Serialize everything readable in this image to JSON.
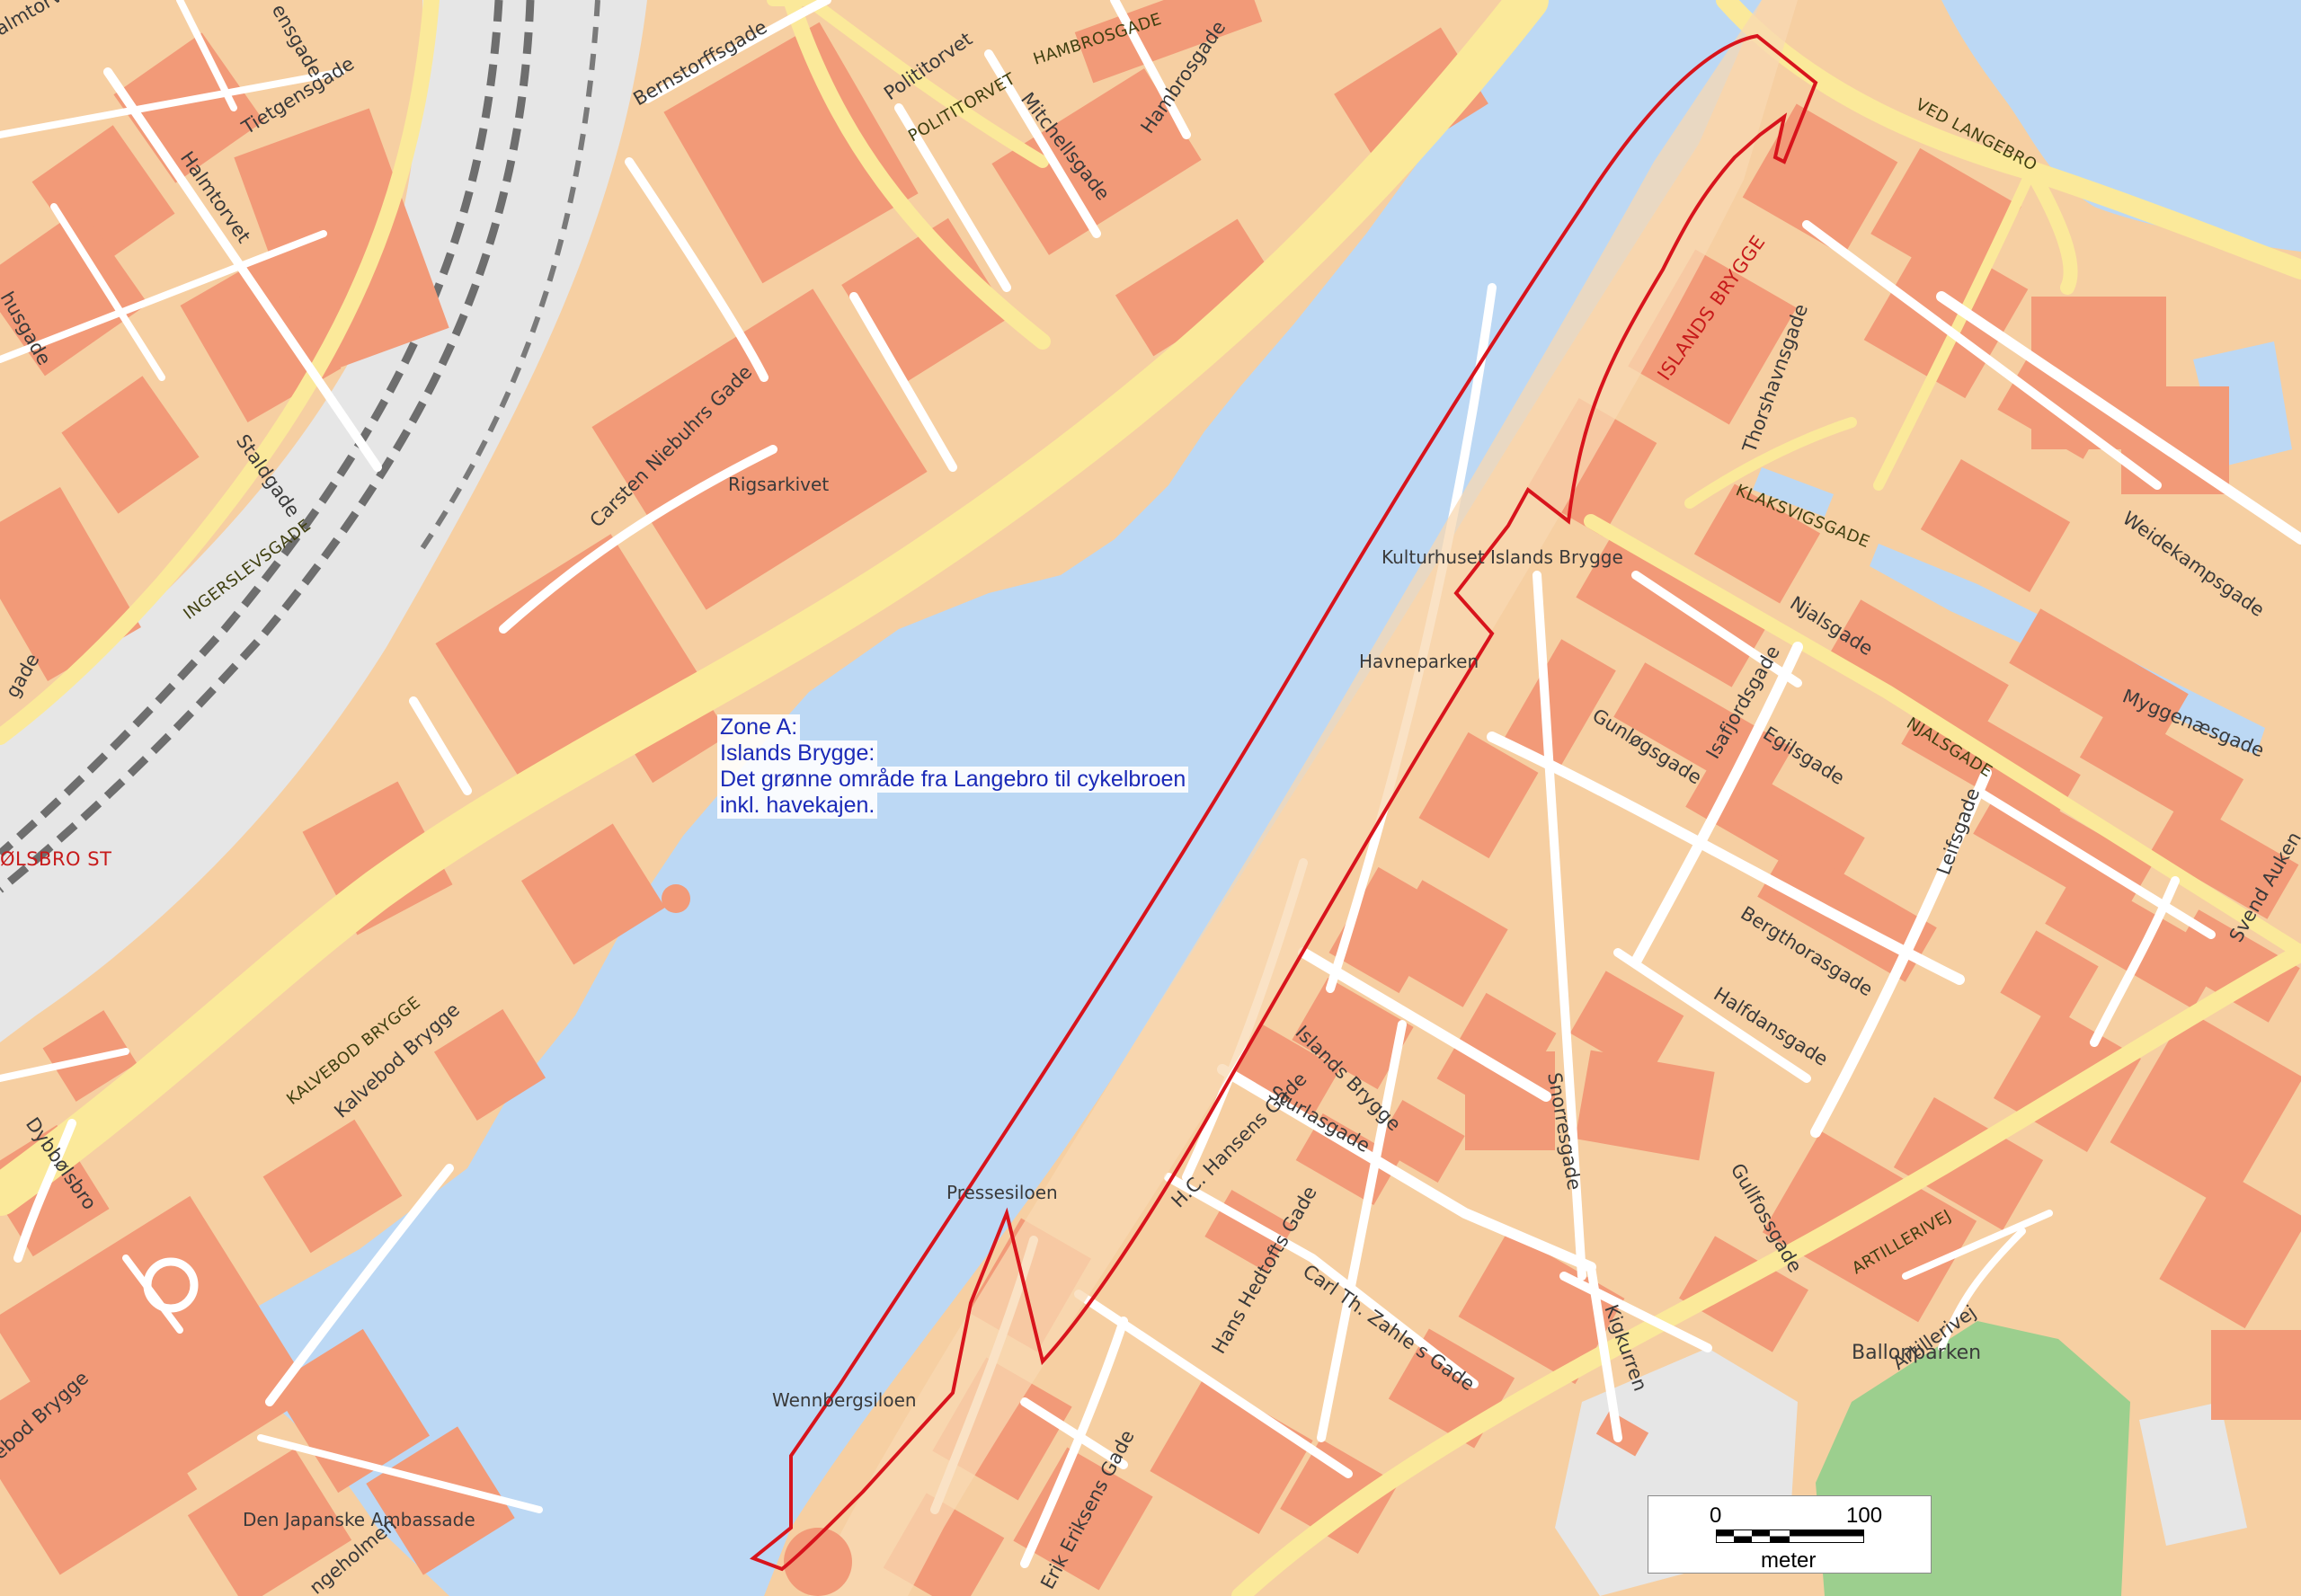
{
  "zone_note": {
    "line1": "Zone A:",
    "line2": "Islands Brygge:",
    "line3": "Det grønne område fra Langebro til cykelbroen",
    "line4": "inkl. havekajen."
  },
  "scale_bar": {
    "start": "0",
    "end": "100",
    "unit": "meter"
  },
  "places": {
    "rigsarkivet": "Rigsarkivet",
    "kulturhuset": "Kulturhuset Islands Brygge",
    "havneparken": "Havneparken",
    "pressesiloen": "Pressesiloen",
    "wennbergsiloen": "Wennbergsiloen",
    "japanske": "Den Japanske Ambassade",
    "ballonparken": "Ballonparken",
    "dybbolsbro_st": "ØLSBRO ST"
  },
  "streets": {
    "bernstorffsgade": "Bernstorffsgade",
    "tietgensgade": "Tietgensgade",
    "halmtorvet": "Halmtorvet",
    "staldgade": "Staldgade",
    "ingerslevsgade": "INGERSLEVSGADE",
    "carsten": "Carsten Niebuhrs Gade",
    "politorvet": "Polititorvet",
    "politorvet_caps": "POLITITORVET",
    "hambrosgade_caps": "HAMBROSGADE",
    "mitchellsgade": "Mitchellsgade",
    "hambrosgade": "Hambrosgade",
    "ved_langebro": "VED LANGEBRO",
    "islands_brygge_caps": "ISLANDS BRYGGE",
    "thorshavnsgade": "Thorshavnsgade",
    "klaksvigsgade": "KLAKSVIGSGADE",
    "weidekampsgade": "Weidekampsgade",
    "njalsgade": "Njalsgade",
    "njalsgade_caps": "NJALSGADE",
    "myggenaesgade": "Myggenæsgade",
    "isafjordsgade": "Isafjordsgade",
    "gunlogsgade": "Gunløgsgade",
    "egilsgade": "Egilsgade",
    "leifsgade": "Leifsgade",
    "bergthorasgade": "Bergthorasgade",
    "halfdansgade": "Halfdansgade",
    "svend": "Svend Auken",
    "islands_brygge": "Islands Brygge",
    "sturlasgade": "Sturlasgade",
    "snorresgade": "Snorresgade",
    "hc_hansens": "H.C. Hansens Gade",
    "hans_hedtofts": "Hans Hedtofts Gade",
    "carl_th_zahle": "Carl Th. Zahle s Gade",
    "kigkurren": "Kigkurren",
    "gullfossgade": "Gullfossgade",
    "artillerivej_caps": "ARTILLERIVEJ",
    "artillerivej": "Artillerivej",
    "kalvebod_caps": "KALVEBOD BRYGGE",
    "kalvebod": "Kalvebod Brygge",
    "dybbolsbro": "Dybbølsbro",
    "bod_brygge": "ebod Brygge",
    "erik_eriksens": "Erik Eriksens Gade",
    "gade_left": "gade",
    "husgade": "husgade",
    "halmtorvet_top": "almtorvet",
    "ensgade": "ensgade",
    "engeholmen": "ngeholmen"
  },
  "colors": {
    "water": "#bcd8f4",
    "land": "#f6cfa2",
    "building": "#f29a78",
    "major_road": "#fbe99a",
    "rail_area": "#e8e8e8",
    "park": "#9ccf8e",
    "zone_boundary": "#d8141c",
    "zone_text": "#1b2ab8"
  }
}
